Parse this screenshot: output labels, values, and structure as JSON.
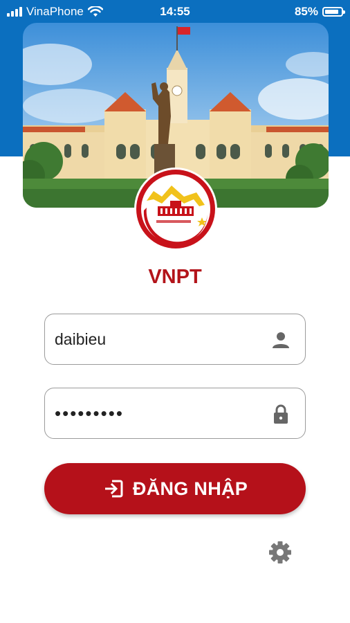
{
  "status_bar": {
    "carrier": "VinaPhone",
    "time": "14:55",
    "battery": "85%",
    "battery_level": 0.85
  },
  "app": {
    "title": "VNPT"
  },
  "login": {
    "username_value": "daibieu",
    "password_value": "•••••••••",
    "submit_label": "ĐĂNG NHẬP"
  },
  "icons": {
    "username_icon": "person-icon",
    "password_icon": "lock-icon",
    "submit_icon": "login-icon",
    "settings_icon": "gear-icon"
  },
  "colors": {
    "brand_red": "#b5111a",
    "header_blue": "#0b6fbf",
    "title_red": "#b3141a"
  }
}
